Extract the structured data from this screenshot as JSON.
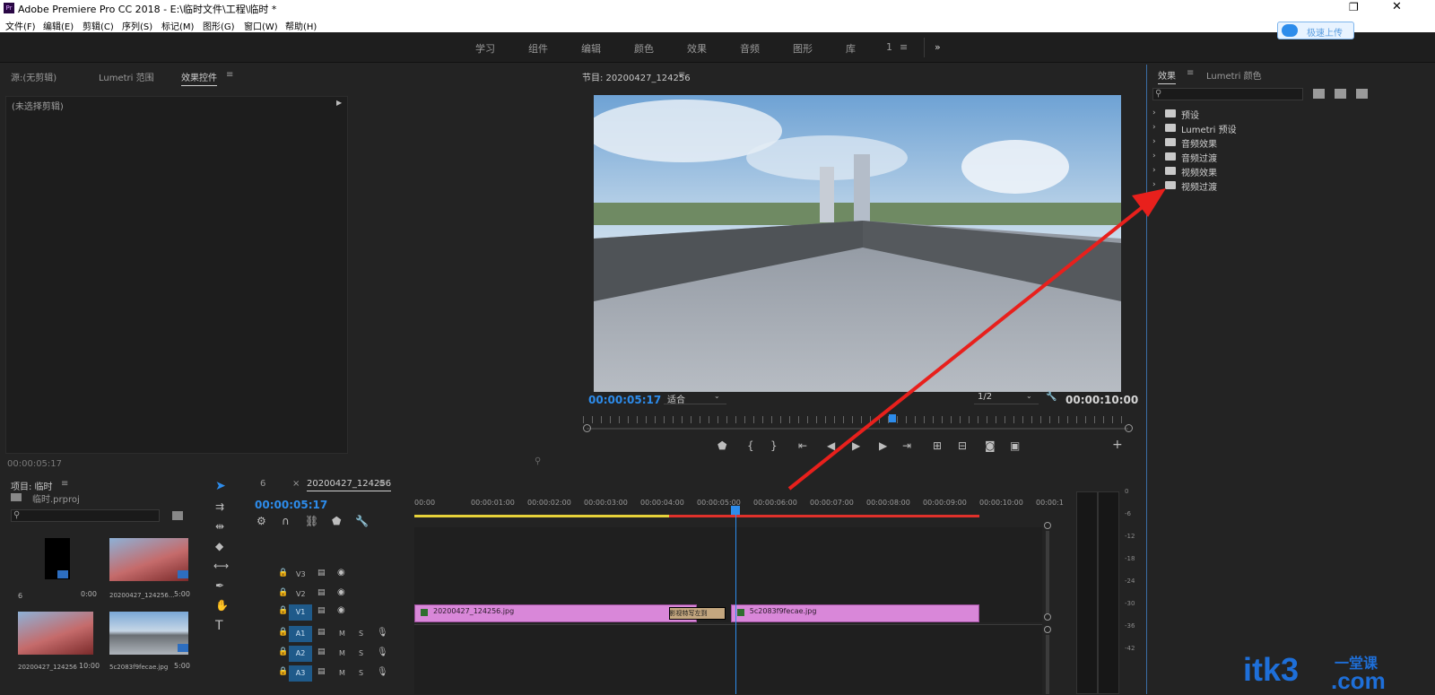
{
  "window": {
    "title": "Adobe Premiere Pro CC 2018 - E:\\临时文件\\工程\\临时 *",
    "app_icon": "Pr"
  },
  "menu": [
    "文件(F)",
    "编辑(E)",
    "剪辑(C)",
    "序列(S)",
    "标记(M)",
    "图形(G)",
    "窗口(W)",
    "帮助(H)"
  ],
  "workspaces": [
    "学习",
    "组件",
    "编辑",
    "颜色",
    "效果",
    "音频",
    "图形",
    "库"
  ],
  "workspace_extra": {
    "number": "1",
    "more": "»"
  },
  "upload_button": "极速上传",
  "source_panel": {
    "tabs": [
      "源:(无剪辑)",
      "Lumetri 范围",
      "效果控件"
    ],
    "no_clip_text": "(未选择剪辑)",
    "timecode": "00:00:05:17"
  },
  "program_monitor": {
    "title": "节目: 20200427_124256",
    "timecode": "00:00:05:17",
    "fit": "适合",
    "resolution": "1/2",
    "duration": "00:00:10:00",
    "playhead_fraction": 0.565
  },
  "effects_panel": {
    "tabs": [
      "效果",
      "Lumetri 颜色"
    ],
    "items": [
      "预设",
      "Lumetri 预设",
      "音频效果",
      "音频过渡",
      "视频效果",
      "视频过渡"
    ]
  },
  "project_panel": {
    "title": "项目: 临时",
    "file": "临时.prproj",
    "items": [
      {
        "name": "6",
        "duration": "0:00"
      },
      {
        "name": "20200427_124256...",
        "duration": "5:00"
      },
      {
        "name": "20200427_124256",
        "duration": "10:00"
      },
      {
        "name": "5c2083f9fecae.jpg",
        "duration": "5:00"
      }
    ]
  },
  "timeline": {
    "tabs": [
      "6",
      "20200427_124256"
    ],
    "timecode": "00:00:05:17",
    "ruler": [
      "00:00",
      "00:00:01:00",
      "00:00:02:00",
      "00:00:03:00",
      "00:00:04:00",
      "00:00:05:00",
      "00:00:06:00",
      "00:00:07:00",
      "00:00:08:00",
      "00:00:09:00",
      "00:00:10:00",
      "00:00:1"
    ],
    "video_tracks": [
      "V3",
      "V2",
      "V1"
    ],
    "audio_tracks": [
      "A1",
      "A2",
      "A3"
    ],
    "track_letters": {
      "mute": "M",
      "solo": "S"
    },
    "clips": [
      {
        "name": "20200427_124256.jpg",
        "start": 0,
        "end": 5.0
      },
      {
        "name": "5c2083f9fecae.jpg",
        "start": 5.6,
        "end": 10.0
      }
    ],
    "transition": "影视特写左到",
    "playhead_seconds": 5.68
  },
  "audio_meter": {
    "scale": [
      "0",
      "-6",
      "-12",
      "-18",
      "-24",
      "-30",
      "-36",
      "-42"
    ]
  },
  "watermark": {
    "text": "itk3",
    "suffix": ".com",
    "chinese": "一堂课"
  },
  "colors": {
    "accent": "#2d8ceb",
    "clip": "#d987d9",
    "arrow": "#e8201c",
    "yellow_bar": "#e6d23a",
    "red_bar": "#e0312b"
  }
}
